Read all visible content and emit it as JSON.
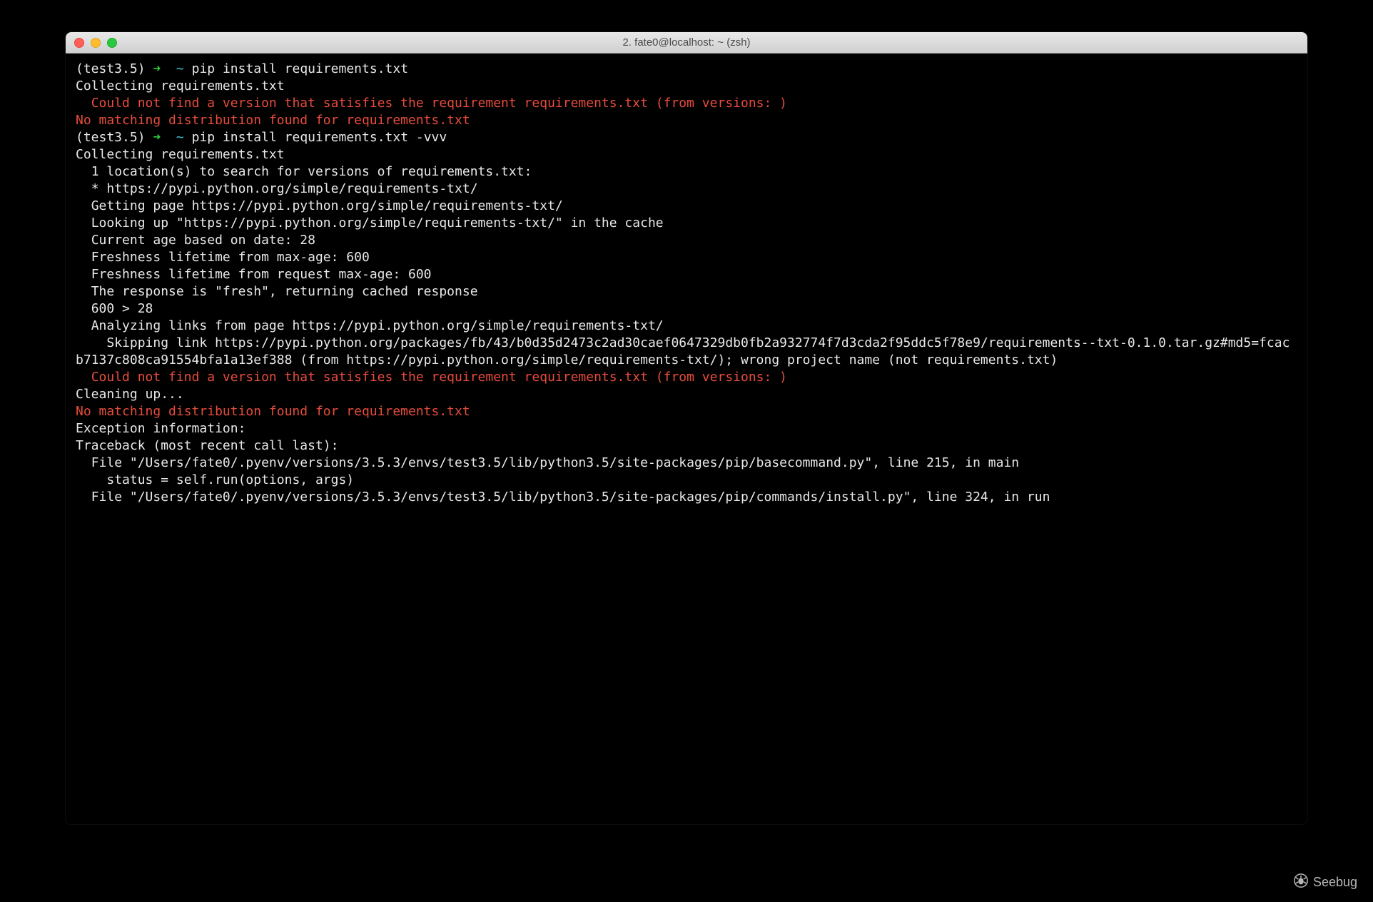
{
  "window": {
    "title": "2. fate0@localhost: ~ (zsh)"
  },
  "prompt": {
    "env": "(test3.5)",
    "arrow": "➜",
    "path": "~",
    "cmd1": "pip install requirements.txt",
    "cmd2": "pip install requirements.txt -vvv"
  },
  "lines": {
    "collecting": "Collecting requirements.txt",
    "err1": "  Could not find a version that satisfies the requirement requirements.txt (from versions: )",
    "err2": "No matching distribution found for requirements.txt",
    "l1": "  1 location(s) to search for versions of requirements.txt:",
    "l2": "  * https://pypi.python.org/simple/requirements-txt/",
    "l3": "  Getting page https://pypi.python.org/simple/requirements-txt/",
    "l4": "  Looking up \"https://pypi.python.org/simple/requirements-txt/\" in the cache",
    "l5": "  Current age based on date: 28",
    "l6": "  Freshness lifetime from max-age: 600",
    "l7": "  Freshness lifetime from request max-age: 600",
    "l8": "  The response is \"fresh\", returning cached response",
    "l9": "  600 > 28",
    "l10": "  Analyzing links from page https://pypi.python.org/simple/requirements-txt/",
    "l11": "    Skipping link https://pypi.python.org/packages/fb/43/b0d35d2473c2ad30caef0647329db0fb2a932774f7d3cda2f95ddc5f78e9/requirements--txt-0.1.0.tar.gz#md5=fcacb7137c808ca91554bfa1a13ef388 (from https://pypi.python.org/simple/requirements-txt/); wrong project name (not requirements.txt)",
    "cleaning": "Cleaning up...",
    "exc": "Exception information:",
    "tb": "Traceback (most recent call last):",
    "f1": "  File \"/Users/fate0/.pyenv/versions/3.5.3/envs/test3.5/lib/python3.5/site-packages/pip/basecommand.py\", line 215, in main",
    "s1": "    status = self.run(options, args)",
    "f2": "  File \"/Users/fate0/.pyenv/versions/3.5.3/envs/test3.5/lib/python3.5/site-packages/pip/commands/install.py\", line 324, in run"
  },
  "watermark": {
    "text": "Seebug"
  }
}
